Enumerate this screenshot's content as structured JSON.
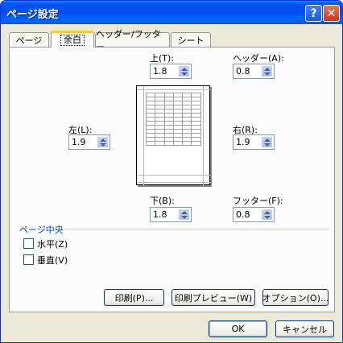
{
  "window": {
    "title": "ページ設定",
    "help_glyph": "?",
    "close_glyph": "✕"
  },
  "tabs": [
    {
      "label": "ページ",
      "active": false
    },
    {
      "label": "余白",
      "active": true
    },
    {
      "label": "ヘッダー/フッター",
      "active": false
    },
    {
      "label": "シート",
      "active": false
    }
  ],
  "margins": {
    "top": {
      "label": "上(T):",
      "value": "1.8"
    },
    "header": {
      "label": "ヘッダー(A):",
      "value": "0.8"
    },
    "left": {
      "label": "左(L):",
      "value": "1.9"
    },
    "right": {
      "label": "右(R):",
      "value": "1.9"
    },
    "bottom": {
      "label": "下(B):",
      "value": "1.8"
    },
    "footer": {
      "label": "フッター(F):",
      "value": "0.8"
    }
  },
  "center": {
    "group_label": "ページ中央",
    "horizontal": {
      "label": "水平(Z)",
      "checked": false
    },
    "vertical": {
      "label": "垂直(V)",
      "checked": false
    }
  },
  "buttons": {
    "print": "印刷(P)...",
    "preview": "印刷プレビュー(W)",
    "options": "オプション(O)...",
    "ok": "OK",
    "cancel": "キャンセル"
  }
}
